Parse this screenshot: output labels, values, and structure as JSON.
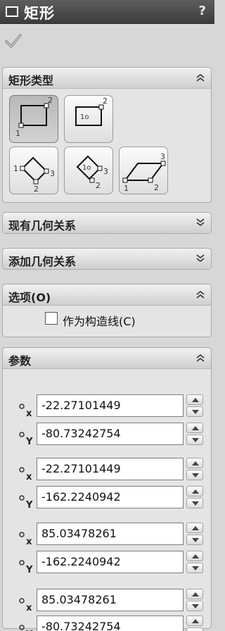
{
  "titlebar": {
    "title": "矩形",
    "help": "?"
  },
  "confirm": {
    "icon": "checkmark-icon"
  },
  "sections": {
    "rect_type": {
      "title": "矩形类型",
      "state": "expanded"
    },
    "existing_relations": {
      "title": "现有几何关系",
      "state": "collapsed"
    },
    "add_relations": {
      "title": "添加几何关系",
      "state": "collapsed"
    },
    "options": {
      "title": "选项(O)",
      "state": "expanded"
    },
    "parameters": {
      "title": "参数",
      "state": "expanded"
    }
  },
  "rect_types": [
    {
      "id": "corner",
      "selected": true
    },
    {
      "id": "center",
      "selected": false
    },
    {
      "id": "3pt-corner",
      "selected": false
    },
    {
      "id": "3pt-center",
      "selected": false
    },
    {
      "id": "parallelogram",
      "selected": false
    }
  ],
  "rect_type_labels": {
    "n1": "1",
    "n2": "2",
    "n3": "3",
    "n1o": "1o"
  },
  "options": {
    "construction_label": "作为构造线(C)",
    "construction_checked": false
  },
  "params": {
    "x_sub": "x",
    "y_sub": "Y",
    "points": [
      {
        "x": "-22.27101449",
        "y": "-80.73242754"
      },
      {
        "x": "-22.27101449",
        "y": "-162.2240942"
      },
      {
        "x": "85.03478261",
        "y": "-162.2240942"
      },
      {
        "x": "85.03478261",
        "y": "-80.73242754"
      }
    ]
  },
  "colors": {
    "titlebar": "#4a4a4a",
    "panel_bg": "#e4e4e4",
    "window_bg": "#d7d7d7"
  }
}
